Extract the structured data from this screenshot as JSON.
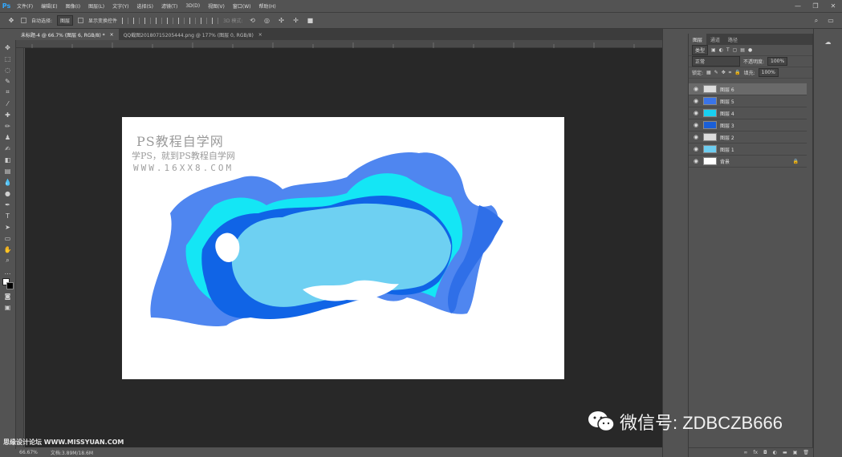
{
  "app": {
    "logo": "Ps",
    "window_buttons": [
      "—",
      "❐",
      "✕"
    ]
  },
  "menu": [
    "文件(F)",
    "编辑(E)",
    "图像(I)",
    "图层(L)",
    "文字(Y)",
    "选择(S)",
    "滤镜(T)",
    "3D(D)",
    "视图(V)",
    "窗口(W)",
    "帮助(H)"
  ],
  "options": {
    "auto_select_label": "自动选择:",
    "auto_select_value": "图层",
    "show_transform_label": "显示变换控件",
    "mode3d_label": "3D 模式:"
  },
  "tabs": [
    {
      "label": "未标题-4 @ 66.7% (图层 6, RGB/8) *",
      "active": true
    },
    {
      "label": "QQ截图20180715205444.png @ 177% (图层 0, RGB/8)",
      "active": false
    }
  ],
  "status": {
    "zoom": "66.67%",
    "doc": "文档:3.89M/18.6M"
  },
  "panel": {
    "tabs": [
      "图层",
      "通道",
      "路径"
    ],
    "filter_kind": "类型",
    "blend_mode": "正常",
    "opacity_label": "不透明度:",
    "opacity": "100%",
    "lock_label": "锁定:",
    "fill_label": "填充:",
    "fill": "100%",
    "layers": [
      {
        "name": "图层 6",
        "selected": true,
        "thumb": "#dddddd"
      },
      {
        "name": "图层 5",
        "selected": false,
        "thumb": "#3a74e8"
      },
      {
        "name": "图层 4",
        "selected": false,
        "thumb": "#19d0f0"
      },
      {
        "name": "图层 3",
        "selected": false,
        "thumb": "#1a5fd8"
      },
      {
        "name": "图层 2",
        "selected": false,
        "thumb": "#dddddd"
      },
      {
        "name": "图层 1",
        "selected": false,
        "thumb": "#6dcdf0"
      },
      {
        "name": "背景",
        "selected": false,
        "thumb": "#ffffff",
        "locked": true
      }
    ],
    "bottom_icons": [
      "fx",
      "◘",
      "◐",
      "▬",
      "▣",
      "🗑"
    ]
  },
  "watermark": {
    "title": "PS教程自学网",
    "subtitle": "学PS，就到PS教程自学网",
    "url": "WWW.16XX8.COM"
  },
  "wechat": {
    "text": "微信号: ZDBCZB666"
  },
  "forum": {
    "text": "思缘设计论坛 WWW.MISSYUAN.COM"
  },
  "colors": {
    "blue": "#4f86f0",
    "cyan": "#14e6f5",
    "deep": "#1064e6",
    "light": "#6ed0f2"
  }
}
